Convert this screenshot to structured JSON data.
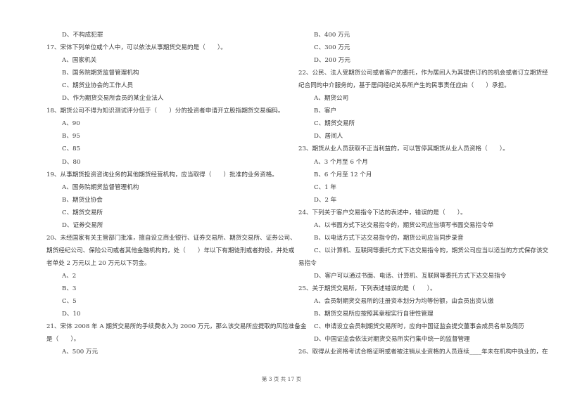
{
  "left_column": [
    {
      "text": "D、不构成犯罪",
      "kind": "option"
    },
    {
      "text": "17、宋体下列单位或个人中，可以依法从事期货交易的是（　　）。",
      "kind": "question"
    },
    {
      "text": "A、国家机关",
      "kind": "option"
    },
    {
      "text": "B、国务院期货监督管理机构",
      "kind": "option"
    },
    {
      "text": "C、期货业协会的工作人员",
      "kind": "option"
    },
    {
      "text": "D、作为期货交易所会员的某企业法人",
      "kind": "option"
    },
    {
      "text": "18、期货公司不得为知识测试评分低于（　　）分的投资者申请开立股指期货交易编码。",
      "kind": "question"
    },
    {
      "text": "A、90",
      "kind": "option"
    },
    {
      "text": "B、95",
      "kind": "option"
    },
    {
      "text": "C、85",
      "kind": "option"
    },
    {
      "text": "D、80",
      "kind": "option"
    },
    {
      "text": "19、从事期货投资咨询业务的其他期货经营机构，应当取得（　　）批准的业务资格。",
      "kind": "question"
    },
    {
      "text": "A、国务院期货监督管理机构",
      "kind": "option"
    },
    {
      "text": "B、期货业协会",
      "kind": "option"
    },
    {
      "text": "C、期货交易所",
      "kind": "option"
    },
    {
      "text": "D、证券交易所",
      "kind": "option"
    },
    {
      "text": "20、未经国家有关主管部门批准，擅自设立商业银行、证券交易所、期货交易所、证券公司、",
      "kind": "question"
    },
    {
      "text": "期货经纪公司、保险公司或者其他金融机构的，处（　　）年以下有期徒刑或者拘役，并处或",
      "kind": "continuation"
    },
    {
      "text": "者单处 2 万元以上 20 万元以下罚金。",
      "kind": "continuation"
    },
    {
      "text": "A、2",
      "kind": "option"
    },
    {
      "text": "B、3",
      "kind": "option"
    },
    {
      "text": "C、5",
      "kind": "option"
    },
    {
      "text": "D、10",
      "kind": "option"
    },
    {
      "text": "21、宋体 2008 年 A 期货交易所的手续费收入为 2000 万元，那么该交易所应提取的风险准备金",
      "kind": "question"
    },
    {
      "text": "是（　　）。",
      "kind": "continuation"
    },
    {
      "text": "A、500 万元",
      "kind": "option"
    }
  ],
  "right_column": [
    {
      "text": "B、400 万元",
      "kind": "option"
    },
    {
      "text": "C、300 万元",
      "kind": "option"
    },
    {
      "text": "D、200 万元",
      "kind": "option"
    },
    {
      "text": "22、公民、法人受期货公司或者客户的委托，作为居间人为其提供订约的机会或者订立期货经",
      "kind": "question"
    },
    {
      "text": "纪合同的中介服务的，基于居间经纪关系所产生的民事责任应由（　　）承担。",
      "kind": "continuation"
    },
    {
      "text": "A、期货公司",
      "kind": "option"
    },
    {
      "text": "B、客户",
      "kind": "option"
    },
    {
      "text": "C、期货交易所",
      "kind": "option"
    },
    {
      "text": "D、居间人",
      "kind": "option"
    },
    {
      "text": "23、期货从业人员获取不正当利益的，可以暂停其期货从业人员资格（　　）。",
      "kind": "question"
    },
    {
      "text": "A、3 个月至 6 个月",
      "kind": "option"
    },
    {
      "text": "B、6 个月至 12 个月",
      "kind": "option"
    },
    {
      "text": "C、1 年",
      "kind": "option"
    },
    {
      "text": "D、2 年",
      "kind": "option"
    },
    {
      "text": "24、下列关于客户交易指令下达的表述中，错误的是（　　）。",
      "kind": "question"
    },
    {
      "text": "A、以书面方式下达交易指令的，期货公司应当填写书面交易指令单",
      "kind": "option"
    },
    {
      "text": "B、以电话方式下达交易指令的，期货公司应当同步录音",
      "kind": "option"
    },
    {
      "text": "C、以计算机、互联网等委托方式下达交易指令的，期货公司应当以适当的方式保存该交",
      "kind": "option"
    },
    {
      "text": "易指令",
      "kind": "continuation"
    },
    {
      "text": "D、客户可以通过书面、电话、计算机、互联网等委托方式下达交易指令",
      "kind": "option"
    },
    {
      "text": "25、关于期货交易所，下列表述错误的是（　　）。",
      "kind": "question"
    },
    {
      "text": "A、会员制期货交易所的注册资本划分为均等份额，由会员出资认缴",
      "kind": "option"
    },
    {
      "text": "B、期货交易所应按照其章程实行自律性管理",
      "kind": "option"
    },
    {
      "text": "C、申请设立会员制期货交易所时，应向中国证监会提交董事会成员名单及简历",
      "kind": "option"
    },
    {
      "text": "D、中国证监会依法对期货交易所实行集中统一的监督管理",
      "kind": "option"
    },
    {
      "text": "26、取得从业资格考试合格证明或者被注销从业资格的人员连续____年未在机构中执业的，在",
      "kind": "question"
    }
  ],
  "footer": {
    "page_label": "第 3 页 共 17 页"
  }
}
